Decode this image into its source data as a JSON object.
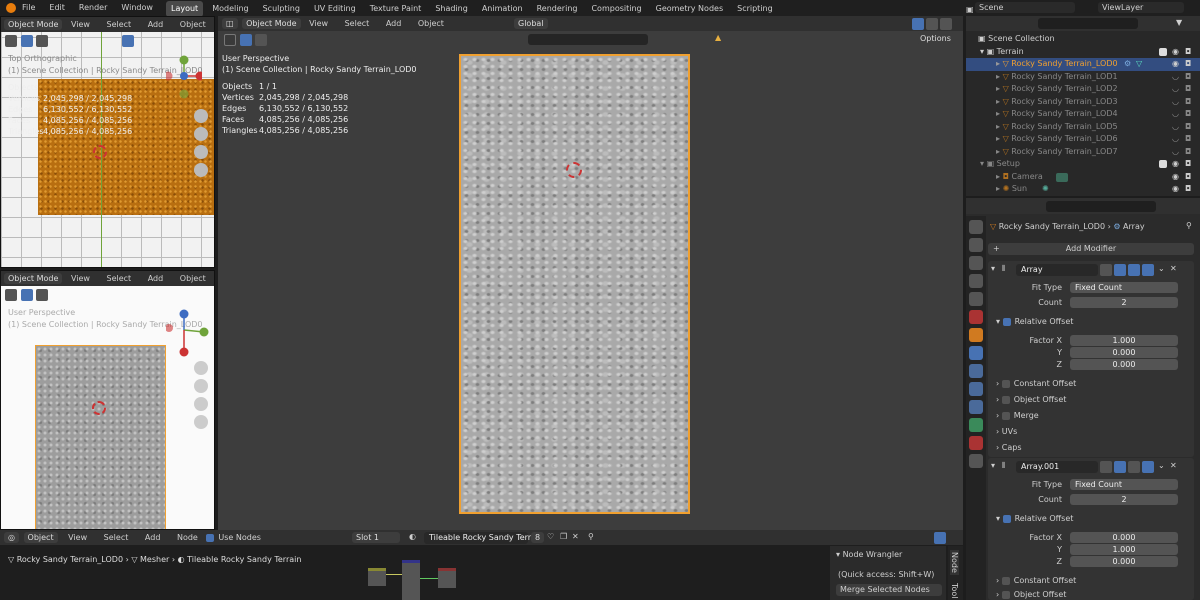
{
  "topbar": {
    "menus": [
      "File",
      "Edit",
      "Render",
      "Window",
      "Help"
    ],
    "workspaces": [
      "Layout",
      "Modeling",
      "Sculpting",
      "UV Editing",
      "Texture Paint",
      "Shading",
      "Animation",
      "Rendering",
      "Compositing",
      "Geometry Nodes",
      "Scripting"
    ],
    "scene": "Scene",
    "view_layer": "ViewLayer"
  },
  "viewport_top_left": {
    "mode": "Object Mode",
    "menus": [
      "View",
      "Select",
      "Add",
      "Object"
    ],
    "title": "Top Orthographic",
    "collection": "(1) Scene Collection | Rocky Sandy Terrain_LOD0",
    "stat_labels": [
      "Objects",
      "Vertices",
      "Edges",
      "Faces",
      "Triangles"
    ],
    "stat_values": [
      "",
      "2,045,298 / 2,045,298",
      "6,130,552 / 6,130,552",
      "4,085,256 / 4,085,256",
      "4,085,256 / 4,085,256"
    ]
  },
  "viewport_bottom_left": {
    "mode": "Object Mode",
    "menus": [
      "View",
      "Select",
      "Add",
      "Object"
    ],
    "title": "User Perspective",
    "collection": "(1) Scene Collection | Rocky Sandy Terrain_LOD0"
  },
  "viewport_main": {
    "mode": "Object Mode",
    "menus": [
      "View",
      "Select",
      "Add",
      "Object"
    ],
    "transform": "Global",
    "options": "Options",
    "title": "User Perspective",
    "collection": "(1) Scene Collection | Rocky Sandy Terrain_LOD0",
    "stat_labels": [
      "Objects",
      "Vertices",
      "Edges",
      "Faces",
      "Triangles"
    ],
    "stat_values": [
      "1 / 1",
      "2,045,298 / 2,045,298",
      "6,130,552 / 6,130,552",
      "4,085,256 / 4,085,256",
      "4,085,256 / 4,085,256"
    ]
  },
  "outliner": {
    "root": "Scene Collection",
    "collections": [
      {
        "name": "Terrain",
        "items": [
          "Rocky Sandy Terrain_LOD0",
          "Rocky Sandy Terrain_LOD1",
          "Rocky Sandy Terrain_LOD2",
          "Rocky Sandy Terrain_LOD3",
          "Rocky Sandy Terrain_LOD4",
          "Rocky Sandy Terrain_LOD5",
          "Rocky Sandy Terrain_LOD6",
          "Rocky Sandy Terrain_LOD7"
        ]
      },
      {
        "name": "Setup",
        "items": [
          "Camera",
          "Sun"
        ]
      }
    ]
  },
  "properties": {
    "breadcrumb_object": "Rocky Sandy Terrain_LOD0",
    "breadcrumb_modifier": "Array",
    "add_modifier": "Add Modifier",
    "modifiers": [
      {
        "name": "Array",
        "fit_type_label": "Fit Type",
        "fit_type": "Fixed Count",
        "count_label": "Count",
        "count": "2",
        "relative_offset": "Relative Offset",
        "factor_x_label": "Factor X",
        "factor_x": "1.000",
        "y_label": "Y",
        "factor_y": "0.000",
        "z_label": "Z",
        "factor_z": "0.000",
        "subpanels": [
          "Constant Offset",
          "Object Offset",
          "Merge",
          "UVs",
          "Caps"
        ]
      },
      {
        "name": "Array.001",
        "fit_type_label": "Fit Type",
        "fit_type": "Fixed Count",
        "count_label": "Count",
        "count": "2",
        "relative_offset": "Relative Offset",
        "factor_x_label": "Factor X",
        "factor_x": "0.000",
        "y_label": "Y",
        "factor_y": "1.000",
        "z_label": "Z",
        "factor_z": "0.000",
        "subpanels": [
          "Constant Offset",
          "Object Offset"
        ]
      }
    ]
  },
  "node_editor": {
    "editor": "Object",
    "menus": [
      "View",
      "Select",
      "Add",
      "Node"
    ],
    "use_nodes": "Use Nodes",
    "slot": "Slot 1",
    "material": "Tileable Rocky Sandy Terrain",
    "users": "8",
    "breadcrumb": [
      "Rocky Sandy Terrain_LOD0",
      "Mesher",
      "Tileable Rocky Sandy Terrain"
    ],
    "side_panel": {
      "title": "Node Wrangler",
      "hint": "(Quick access: Shift+W)",
      "button": "Merge Selected Nodes"
    },
    "side_tabs": [
      "Node",
      "Tool"
    ]
  },
  "colors": {
    "accent": "#4772b3",
    "selection": "#f0a030",
    "active_tab": "#4a4a4a"
  }
}
